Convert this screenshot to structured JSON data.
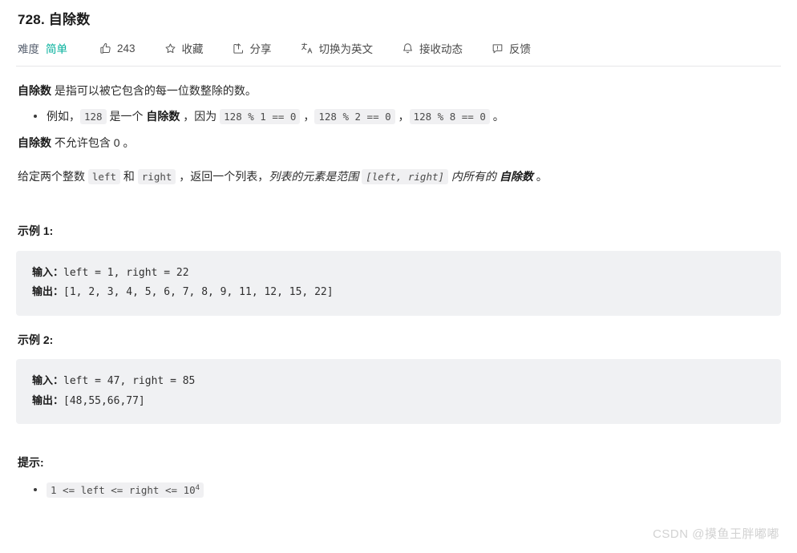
{
  "problem": {
    "title": "728. 自除数",
    "difficulty_label": "难度",
    "difficulty_value": "简单"
  },
  "toolbar": {
    "likes_count": "243",
    "favorite_label": "收藏",
    "share_label": "分享",
    "translate_label": "切换为英文",
    "subscribe_label": "接收动态",
    "feedback_label": "反馈",
    "icons": {
      "like": "thumbs-up-icon",
      "favorite": "star-icon",
      "share": "share-icon",
      "translate": "translate-icon",
      "subscribe": "bell-icon",
      "feedback": "feedback-icon"
    }
  },
  "description": {
    "definition_term": "自除数",
    "definition_rest": " 是指可以被它包含的每一位数整除的数。",
    "example_bullet": {
      "prefix": "例如，",
      "code_number": "128",
      "middle": " 是一个 ",
      "term": "自除数",
      "because": " ，因为 ",
      "code_1": "128 % 1 == 0",
      "sep_1": " ，",
      "code_2": "128 % 2 == 0",
      "sep_2": " ，",
      "code_3": "128 % 8 == 0",
      "suffix": " 。"
    },
    "rule_term": "自除数",
    "rule_rest": " 不允许包含 0 。",
    "task": {
      "prefix": "给定两个整数 ",
      "code_left": "left",
      "and": " 和 ",
      "code_right": "right",
      "middle": " ，返回一个列表，",
      "italic_1": "列表的元素是范围 ",
      "italic_code": "[left, right]",
      "italic_2": " 内所有的 ",
      "italic_bold": "自除数",
      "suffix": " 。"
    }
  },
  "examples": [
    {
      "heading": "示例 1:",
      "input_label": "输入：",
      "input_value": "left = 1, right = 22",
      "output_label": "输出：",
      "output_value": "[1, 2, 3, 4, 5, 6, 7, 8, 9, 11, 12, 15, 22]"
    },
    {
      "heading": "示例 2:",
      "input_label": "输入：",
      "input_value": "left = 47, right = 85",
      "output_label": "输出：",
      "output_value": "[48,55,66,77]"
    }
  ],
  "hints": {
    "heading": "提示:",
    "constraint_main": "1 <= left <= right <= 10",
    "constraint_sup": "4"
  },
  "watermark": {
    "text": "CSDN @摸鱼王胖嘟嘟"
  },
  "colors": {
    "difficulty_easy": "#00af9b",
    "code_background": "#f0f1f3",
    "inline_code_background": "#f0f0f2",
    "divider": "#e7e7e9",
    "watermark": "#d2d2d2"
  }
}
